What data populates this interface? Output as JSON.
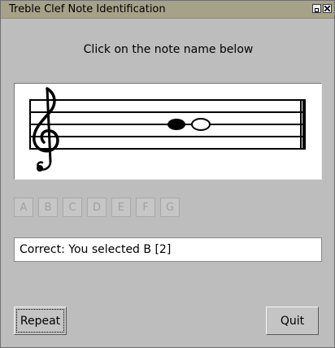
{
  "window": {
    "title": "Treble Clef Note Identification"
  },
  "instruction": "Click on the note name below",
  "note_buttons": [
    "A",
    "B",
    "C",
    "D",
    "E",
    "F",
    "G"
  ],
  "status": "Correct: You selected B [2]",
  "buttons": {
    "repeat": "Repeat",
    "quit": "Quit"
  },
  "staff": {
    "clef": "treble",
    "notes": [
      {
        "name": "played-note",
        "style": "filled-whole"
      },
      {
        "name": "answer-note",
        "style": "open-whole"
      }
    ]
  }
}
